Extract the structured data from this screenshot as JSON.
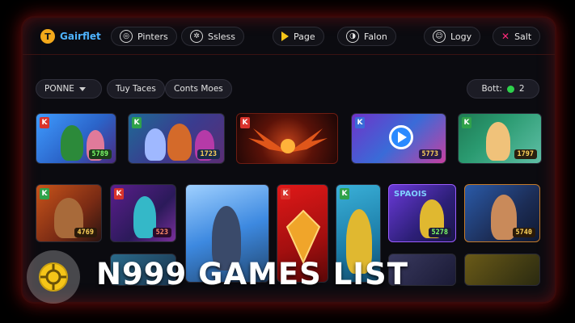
{
  "nav": {
    "brand": "Gairflet",
    "items": [
      {
        "label": "Pinters",
        "icon": "gamepad-icon"
      },
      {
        "label": "Ssless",
        "icon": "settings-icon"
      },
      {
        "label": "Page",
        "icon": "play-icon"
      },
      {
        "label": "Falon",
        "icon": "chat-icon"
      },
      {
        "label": "Logy",
        "icon": "user-icon"
      },
      {
        "label": "Salt",
        "icon": "close-icon"
      }
    ]
  },
  "filters": {
    "dropdown": "PONNE",
    "chips": [
      "Tuy Taces",
      "Conts Moes"
    ],
    "bott_label": "Bott:",
    "bott_count": "2"
  },
  "tiles": [
    {
      "price": "5789",
      "corner": "K"
    },
    {
      "price": "1723",
      "corner": "K"
    },
    {
      "price": "",
      "corner": "K"
    },
    {
      "price": "5773",
      "corner": "K"
    },
    {
      "price": "1797",
      "corner": "K"
    },
    {
      "price": "4769",
      "corner": "K"
    },
    {
      "price": "523",
      "corner": "K"
    },
    {
      "price": "",
      "corner": ""
    },
    {
      "price": "",
      "corner": "K"
    },
    {
      "price": "",
      "corner": "K"
    },
    {
      "price": "5278",
      "corner": "",
      "title": "SPAOIS"
    },
    {
      "price": "5740",
      "corner": ""
    }
  ],
  "overlay": {
    "title": "N999 GAMES LIST"
  },
  "colors": {
    "accent_red": "#d4161a",
    "brand_blue": "#4fb3ff",
    "badge_orange": "#f3a91b",
    "online_green": "#2ed14c"
  }
}
